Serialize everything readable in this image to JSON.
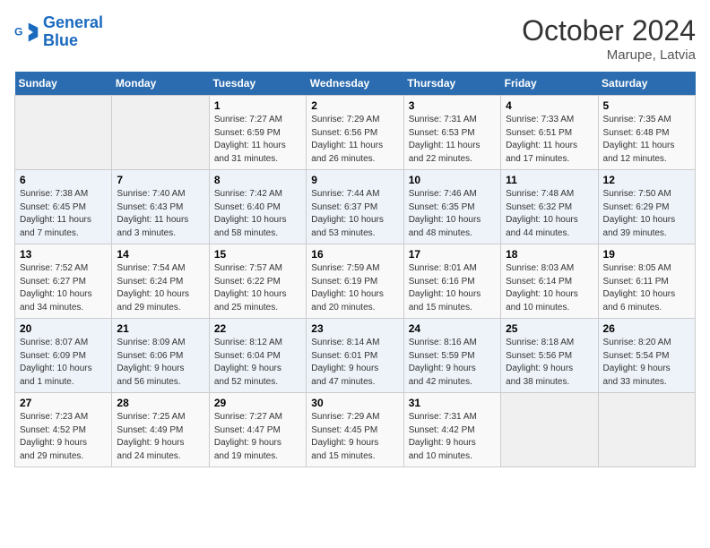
{
  "header": {
    "logo_line1": "General",
    "logo_line2": "Blue",
    "month": "October 2024",
    "location": "Marupe, Latvia"
  },
  "weekdays": [
    "Sunday",
    "Monday",
    "Tuesday",
    "Wednesday",
    "Thursday",
    "Friday",
    "Saturday"
  ],
  "weeks": [
    [
      {
        "day": "",
        "info": ""
      },
      {
        "day": "",
        "info": ""
      },
      {
        "day": "1",
        "info": "Sunrise: 7:27 AM\nSunset: 6:59 PM\nDaylight: 11 hours\nand 31 minutes."
      },
      {
        "day": "2",
        "info": "Sunrise: 7:29 AM\nSunset: 6:56 PM\nDaylight: 11 hours\nand 26 minutes."
      },
      {
        "day": "3",
        "info": "Sunrise: 7:31 AM\nSunset: 6:53 PM\nDaylight: 11 hours\nand 22 minutes."
      },
      {
        "day": "4",
        "info": "Sunrise: 7:33 AM\nSunset: 6:51 PM\nDaylight: 11 hours\nand 17 minutes."
      },
      {
        "day": "5",
        "info": "Sunrise: 7:35 AM\nSunset: 6:48 PM\nDaylight: 11 hours\nand 12 minutes."
      }
    ],
    [
      {
        "day": "6",
        "info": "Sunrise: 7:38 AM\nSunset: 6:45 PM\nDaylight: 11 hours\nand 7 minutes."
      },
      {
        "day": "7",
        "info": "Sunrise: 7:40 AM\nSunset: 6:43 PM\nDaylight: 11 hours\nand 3 minutes."
      },
      {
        "day": "8",
        "info": "Sunrise: 7:42 AM\nSunset: 6:40 PM\nDaylight: 10 hours\nand 58 minutes."
      },
      {
        "day": "9",
        "info": "Sunrise: 7:44 AM\nSunset: 6:37 PM\nDaylight: 10 hours\nand 53 minutes."
      },
      {
        "day": "10",
        "info": "Sunrise: 7:46 AM\nSunset: 6:35 PM\nDaylight: 10 hours\nand 48 minutes."
      },
      {
        "day": "11",
        "info": "Sunrise: 7:48 AM\nSunset: 6:32 PM\nDaylight: 10 hours\nand 44 minutes."
      },
      {
        "day": "12",
        "info": "Sunrise: 7:50 AM\nSunset: 6:29 PM\nDaylight: 10 hours\nand 39 minutes."
      }
    ],
    [
      {
        "day": "13",
        "info": "Sunrise: 7:52 AM\nSunset: 6:27 PM\nDaylight: 10 hours\nand 34 minutes."
      },
      {
        "day": "14",
        "info": "Sunrise: 7:54 AM\nSunset: 6:24 PM\nDaylight: 10 hours\nand 29 minutes."
      },
      {
        "day": "15",
        "info": "Sunrise: 7:57 AM\nSunset: 6:22 PM\nDaylight: 10 hours\nand 25 minutes."
      },
      {
        "day": "16",
        "info": "Sunrise: 7:59 AM\nSunset: 6:19 PM\nDaylight: 10 hours\nand 20 minutes."
      },
      {
        "day": "17",
        "info": "Sunrise: 8:01 AM\nSunset: 6:16 PM\nDaylight: 10 hours\nand 15 minutes."
      },
      {
        "day": "18",
        "info": "Sunrise: 8:03 AM\nSunset: 6:14 PM\nDaylight: 10 hours\nand 10 minutes."
      },
      {
        "day": "19",
        "info": "Sunrise: 8:05 AM\nSunset: 6:11 PM\nDaylight: 10 hours\nand 6 minutes."
      }
    ],
    [
      {
        "day": "20",
        "info": "Sunrise: 8:07 AM\nSunset: 6:09 PM\nDaylight: 10 hours\nand 1 minute."
      },
      {
        "day": "21",
        "info": "Sunrise: 8:09 AM\nSunset: 6:06 PM\nDaylight: 9 hours\nand 56 minutes."
      },
      {
        "day": "22",
        "info": "Sunrise: 8:12 AM\nSunset: 6:04 PM\nDaylight: 9 hours\nand 52 minutes."
      },
      {
        "day": "23",
        "info": "Sunrise: 8:14 AM\nSunset: 6:01 PM\nDaylight: 9 hours\nand 47 minutes."
      },
      {
        "day": "24",
        "info": "Sunrise: 8:16 AM\nSunset: 5:59 PM\nDaylight: 9 hours\nand 42 minutes."
      },
      {
        "day": "25",
        "info": "Sunrise: 8:18 AM\nSunset: 5:56 PM\nDaylight: 9 hours\nand 38 minutes."
      },
      {
        "day": "26",
        "info": "Sunrise: 8:20 AM\nSunset: 5:54 PM\nDaylight: 9 hours\nand 33 minutes."
      }
    ],
    [
      {
        "day": "27",
        "info": "Sunrise: 7:23 AM\nSunset: 4:52 PM\nDaylight: 9 hours\nand 29 minutes."
      },
      {
        "day": "28",
        "info": "Sunrise: 7:25 AM\nSunset: 4:49 PM\nDaylight: 9 hours\nand 24 minutes."
      },
      {
        "day": "29",
        "info": "Sunrise: 7:27 AM\nSunset: 4:47 PM\nDaylight: 9 hours\nand 19 minutes."
      },
      {
        "day": "30",
        "info": "Sunrise: 7:29 AM\nSunset: 4:45 PM\nDaylight: 9 hours\nand 15 minutes."
      },
      {
        "day": "31",
        "info": "Sunrise: 7:31 AM\nSunset: 4:42 PM\nDaylight: 9 hours\nand 10 minutes."
      },
      {
        "day": "",
        "info": ""
      },
      {
        "day": "",
        "info": ""
      }
    ]
  ]
}
